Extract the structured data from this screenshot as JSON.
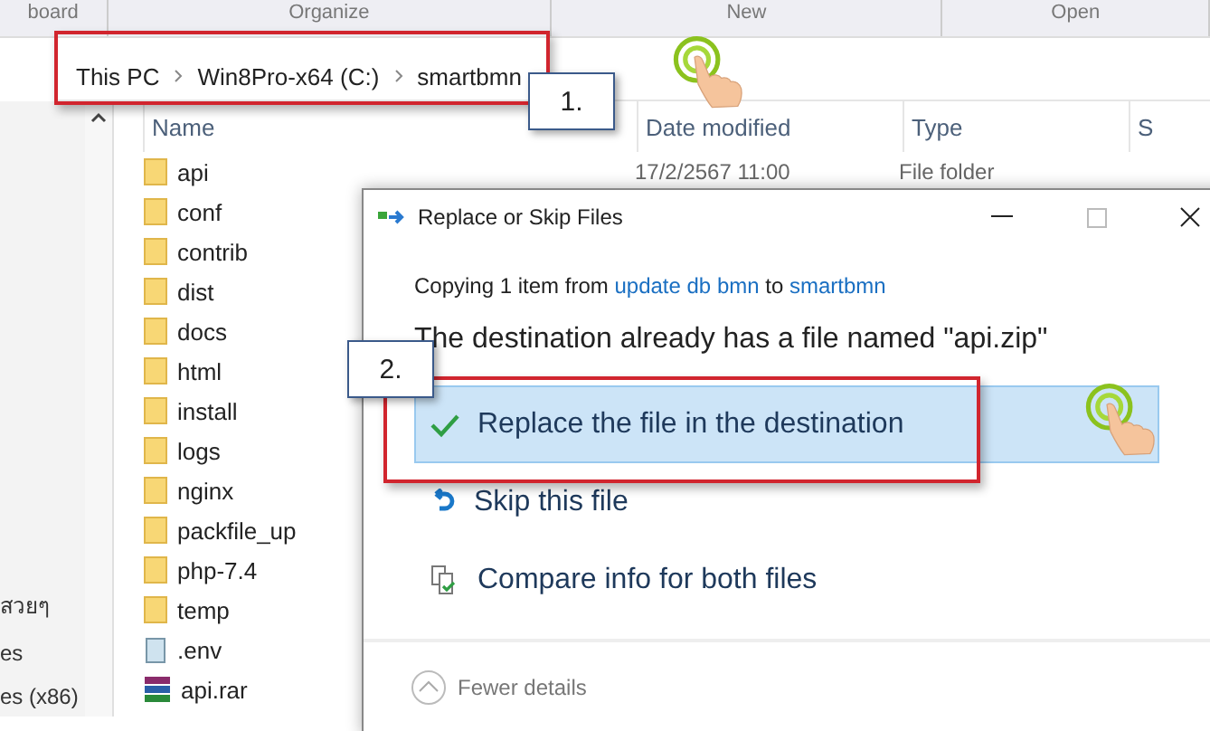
{
  "ribbon_groups": [
    "board",
    "Organize",
    "New",
    "Open"
  ],
  "breadcrumb": [
    "This PC",
    "Win8Pro-x64 (C:)",
    "smartbmn"
  ],
  "nav_items": [
    "สวยๆ",
    "es",
    "es (x86)"
  ],
  "columns": [
    "Name",
    "Date modified",
    "Type",
    "S"
  ],
  "files": [
    {
      "name": "api",
      "kind": "folder",
      "date": "17/2/2567 11:00",
      "type": "File folder"
    },
    {
      "name": "conf",
      "kind": "folder"
    },
    {
      "name": "contrib",
      "kind": "folder"
    },
    {
      "name": "dist",
      "kind": "folder"
    },
    {
      "name": "docs",
      "kind": "folder"
    },
    {
      "name": "html",
      "kind": "folder"
    },
    {
      "name": "install",
      "kind": "folder"
    },
    {
      "name": "logs",
      "kind": "folder"
    },
    {
      "name": "nginx",
      "kind": "folder"
    },
    {
      "name": "packfile_up",
      "kind": "folder"
    },
    {
      "name": "php-7.4",
      "kind": "folder"
    },
    {
      "name": "temp",
      "kind": "folder"
    },
    {
      "name": ".env",
      "kind": "text"
    },
    {
      "name": "api.rar",
      "kind": "archive"
    }
  ],
  "dialog": {
    "title": "Replace or Skip Files",
    "copying": "Copying 1 item from **update db bmn** to **smartbmn**",
    "message": "The destination already has a file named \"api.zip\"",
    "options": [
      {
        "label": "Replace the file in the destination",
        "kind": "replace",
        "selected": true
      },
      {
        "label": "Skip this file",
        "kind": "skip",
        "selected": false
      },
      {
        "label": "Compare info for both files",
        "kind": "compare",
        "selected": false
      }
    ],
    "details_toggle": "Fewer details"
  },
  "callouts": [
    "1.",
    "2."
  ]
}
